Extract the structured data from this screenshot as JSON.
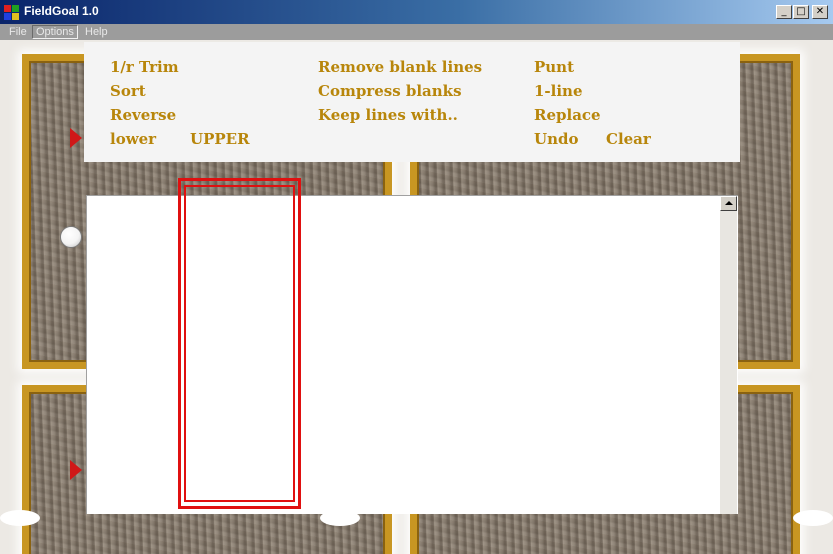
{
  "window": {
    "title": "FieldGoal 1.0",
    "minimize_glyph": "_",
    "maximize_glyph": "□",
    "close_glyph": "✕"
  },
  "menubar": {
    "items": [
      "File",
      "Options",
      "Help"
    ],
    "active": "Options"
  },
  "commands": {
    "trim": "1/r Trim",
    "sort": "Sort",
    "reverse": "Reverse",
    "lower": "lower",
    "upper": "UPPER",
    "remove_blank_lines": "Remove blank lines",
    "compress_blanks": "Compress blanks",
    "keep_lines_with": "Keep  lines with..",
    "punt": "Punt",
    "one_line": "1-line",
    "replace": "Replace",
    "undo": "Undo",
    "clear": "Clear"
  },
  "editor": {
    "text": ""
  },
  "colors": {
    "command_text": "#b8860b",
    "frame_gold": "#c89622",
    "selection_red": "#e01010",
    "marker_red": "#d01818"
  },
  "icons": [
    "app-icon",
    "minimize-icon",
    "maximize-icon",
    "close-icon",
    "x-marker-icon",
    "arrow-marker-icon",
    "football-icon",
    "scroll-up-icon"
  ]
}
